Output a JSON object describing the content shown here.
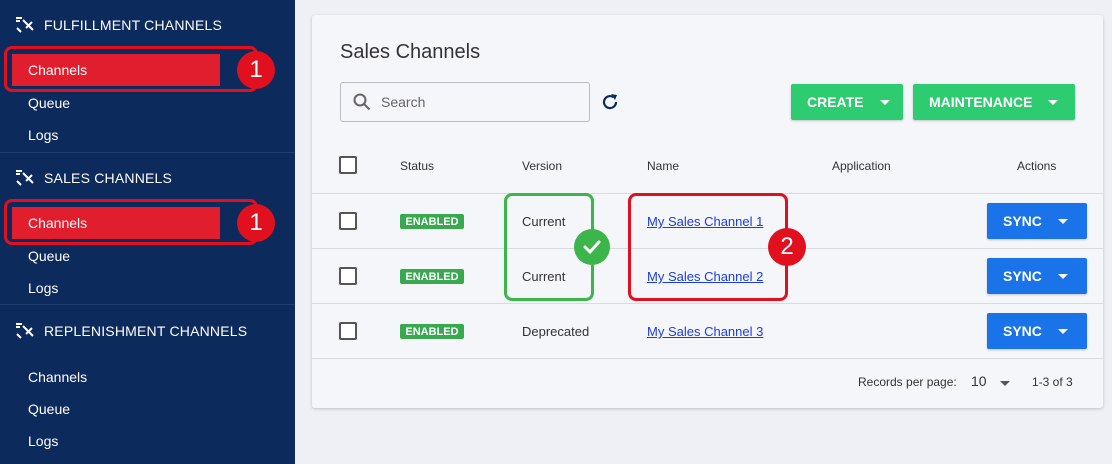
{
  "sidebar": {
    "sections": [
      {
        "title": "FULFILLMENT CHANNELS",
        "items": [
          "Channels",
          "Queue",
          "Logs"
        ]
      },
      {
        "title": "SALES CHANNELS",
        "items": [
          "Channels",
          "Queue",
          "Logs"
        ]
      },
      {
        "title": "REPLENISHMENT CHANNELS",
        "items": [
          "Channels",
          "Queue",
          "Logs"
        ]
      }
    ],
    "badge1": "1"
  },
  "main": {
    "title": "Sales Channels",
    "search_placeholder": "Search",
    "create_label": "CREATE",
    "maintenance_label": "MAINTENANCE",
    "columns": [
      "Status",
      "Version",
      "Name",
      "Application",
      "Actions"
    ],
    "rows": [
      {
        "status": "ENABLED",
        "version": "Current",
        "name": "My Sales Channel 1",
        "action": "SYNC"
      },
      {
        "status": "ENABLED",
        "version": "Current",
        "name": "My Sales Channel 2",
        "action": "SYNC"
      },
      {
        "status": "ENABLED",
        "version": "Deprecated",
        "name": "My Sales Channel 3",
        "action": "SYNC"
      }
    ],
    "badge2": "2",
    "footer": {
      "records_label": "Records per page:",
      "records_value": "10",
      "range": "1-3 of 3"
    }
  },
  "colors": {
    "sidebar_bg": "#0d2a5c",
    "active_red": "#e01e2d",
    "green": "#2ecc71",
    "blue": "#1a73e8",
    "enabled": "#38a94f"
  }
}
